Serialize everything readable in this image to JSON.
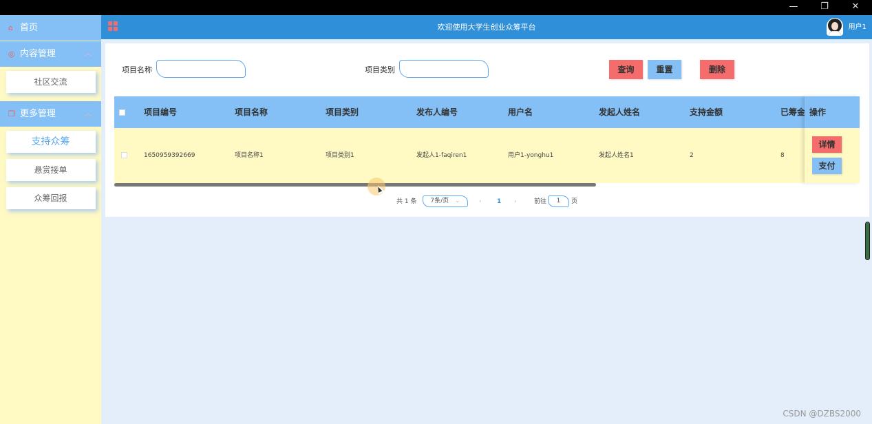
{
  "window": {
    "minimize_icon": "—",
    "restore_icon": "❐",
    "close_icon": "✕"
  },
  "sidebar": {
    "home": {
      "label": "首页",
      "icon": "home-icon"
    },
    "groups": [
      {
        "label": "内容管理",
        "items": [
          {
            "label": "社区交流"
          }
        ]
      },
      {
        "label": "更多管理",
        "items": [
          {
            "label": "支持众筹",
            "active": true
          },
          {
            "label": "悬赏接单"
          },
          {
            "label": "众筹回报"
          }
        ]
      }
    ]
  },
  "header": {
    "title": "欢迎使用大学生创业众筹平台",
    "user": "用户1"
  },
  "search": {
    "name_label": "项目名称",
    "name_value": "",
    "type_label": "项目类别",
    "type_value": "",
    "query_button": "查询",
    "reset_button": "重置",
    "delete_button": "删除"
  },
  "table": {
    "columns": [
      "项目编号",
      "项目名称",
      "项目类别",
      "发布人编号",
      "用户名",
      "发起人姓名",
      "支持金额",
      "已筹金额"
    ],
    "rows": [
      {
        "cells": [
          "1650959392669",
          "项目名称1",
          "项目类别1",
          "发起人1-faqiren1",
          "用户1-yonghu1",
          "发起人姓名1",
          "2",
          "8"
        ]
      }
    ],
    "op_header": "操作",
    "detail_button": "详情",
    "pay_button": "支付"
  },
  "pagination": {
    "total_prefix": "共",
    "total": "1",
    "total_suffix": "条",
    "page_size": "7条/页",
    "prev": "‹",
    "current": "1",
    "next": "›",
    "goto_label": "前往",
    "goto_value": "1",
    "page_suffix": "页"
  },
  "watermark": "CSDN @DZBS2000",
  "colors": {
    "sidebar_bg": "#fff9c4",
    "header_blue": "#2f8fd8",
    "light_blue": "#84c0f5",
    "red": "#f56c6c",
    "page_bg": "#e3eefa"
  }
}
